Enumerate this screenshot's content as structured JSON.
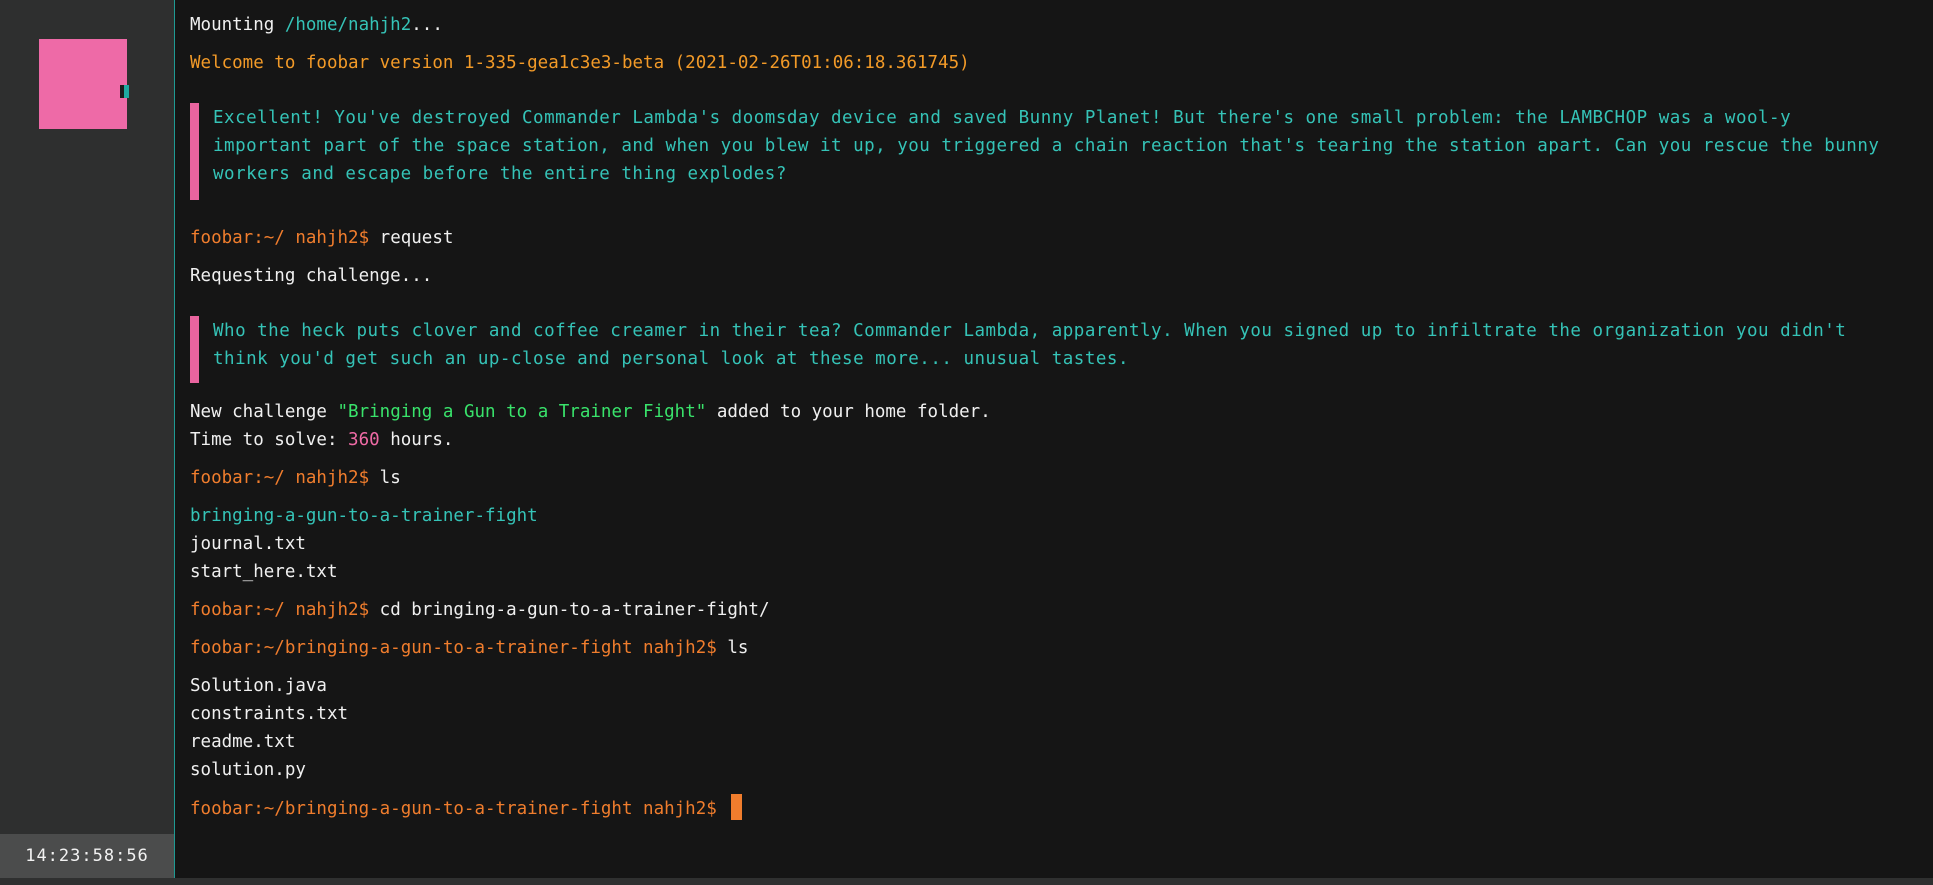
{
  "sidebar": {
    "clock": "14:23:58:56"
  },
  "terminal": {
    "mount": {
      "label": "Mounting ",
      "path": "/home/nahjh2",
      "ellipsis": "..."
    },
    "welcome": "Welcome to foobar version 1-335-gea1c3e3-beta (2021-02-26T01:06:18.361745)",
    "intro_message": "Excellent! You've destroyed Commander Lambda's doomsday device and saved Bunny Planet! But there's one small problem: the LAMBCHOP was a wool-y important part of the space station, and when you blew it up, you triggered a chain reaction that's tearing the station apart. Can you rescue the bunny workers and escape before the entire thing explodes?",
    "cmd1": {
      "prompt": "foobar:~/ nahjh2$ ",
      "command": "request"
    },
    "requesting": "Requesting challenge...",
    "challenge_message": "Who the heck puts clover and coffee creamer in their tea? Commander Lambda, apparently. When you signed up to infiltrate the organization you didn't think you'd get such an up-close and personal look at these more... unusual tastes.",
    "new_challenge": {
      "prefix": "New challenge ",
      "name": "\"Bringing a Gun to a Trainer Fight\"",
      "suffix": " added to your home folder."
    },
    "time_to_solve": {
      "prefix": "Time to solve: ",
      "hours": "360",
      "suffix": " hours."
    },
    "cmd2": {
      "prompt": "foobar:~/ nahjh2$ ",
      "command": "ls"
    },
    "home_listing": {
      "folder": "bringing-a-gun-to-a-trainer-fight",
      "files": [
        "journal.txt",
        "start_here.txt"
      ]
    },
    "cmd3": {
      "prompt": "foobar:~/ nahjh2$ ",
      "command": "cd bringing-a-gun-to-a-trainer-fight/"
    },
    "cmd4": {
      "prompt": "foobar:~/bringing-a-gun-to-a-trainer-fight nahjh2$ ",
      "command": "ls"
    },
    "challenge_listing": [
      "Solution.java",
      "constraints.txt",
      "readme.txt",
      "solution.py"
    ],
    "current_prompt": "foobar:~/bringing-a-gun-to-a-trainer-fight nahjh2$ "
  },
  "colors": {
    "accent_pink": "#ee6aa7",
    "teal": "#35c3b7",
    "prompt_orange": "#f07d2d",
    "welcome_orange": "#f29a28",
    "challenge_green": "#39e36b"
  }
}
